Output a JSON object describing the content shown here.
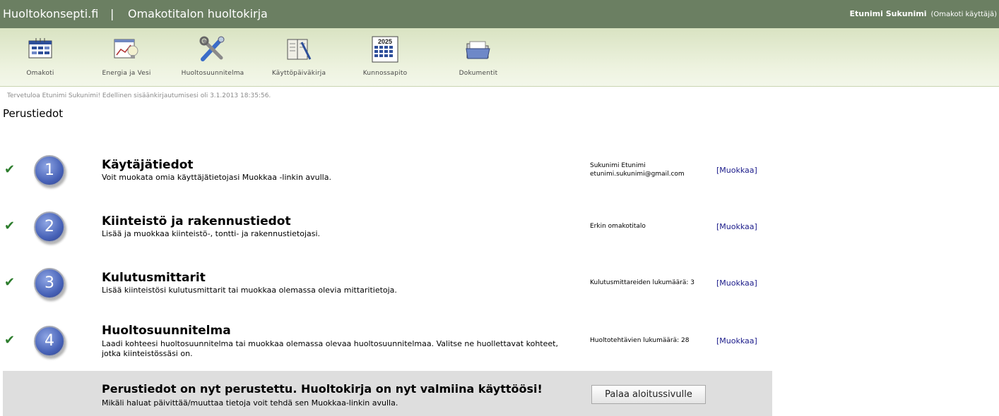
{
  "header": {
    "brand": "Huoltokonsepti.fi",
    "separator": "|",
    "app_title": "Omakotitalon huoltokirja",
    "user_name": "Etunimi Sukunimi",
    "user_role": "(Omakoti käyttäjä)"
  },
  "toolbar": {
    "items": [
      {
        "label": "Omakoti",
        "icon": "calendar-grid-icon"
      },
      {
        "label": "Energia ja Vesi",
        "icon": "chart-lightbulb-icon"
      },
      {
        "label": "Huoltosuunnitelma",
        "icon": "tools-icon"
      },
      {
        "label": "Käyttöpäiväkirja",
        "icon": "notebook-pen-icon"
      },
      {
        "label": "Kunnossapito",
        "icon": "calendar-2025-icon",
        "icon_text": "2025"
      },
      {
        "label": "Dokumentit",
        "icon": "folder-icon"
      }
    ]
  },
  "welcome": "Tervetuloa Etunimi Sukunimi! Edellinen sisäänkirjautumisesi oli 3.1.2013 18:35:56.",
  "page_title": "Perustiedot",
  "steps": [
    {
      "number": "1",
      "title": "Käytäjätiedot",
      "desc": "Voit muokata omia käyttäjätietojasi Muokkaa -linkin avulla.",
      "info_line1": "Sukunimi Etunimi",
      "info_line2": "etunimi.sukunimi@gmail.com",
      "edit": "[Muokkaa]",
      "check": "✔"
    },
    {
      "number": "2",
      "title": "Kiinteistö ja rakennustiedot",
      "desc": "Lisää ja muokkaa kiinteistö-, tontti- ja rakennustietojasi.",
      "info_line1": "Erkin omakotitalo",
      "info_line2": "",
      "edit": "[Muokkaa]",
      "check": "✔"
    },
    {
      "number": "3",
      "title": "Kulutusmittarit",
      "desc": "Lisää kiinteistösi kulutusmittarit tai muokkaa olemassa olevia mittaritietoja.",
      "info_line1": "Kulutusmittareiden lukumäärä: 3",
      "info_line2": "",
      "edit": "[Muokkaa]",
      "check": "✔"
    },
    {
      "number": "4",
      "title": "Huoltosuunnitelma",
      "desc": "Laadi kohteesi huoltosuunnitelma tai muokkaa olemassa olevaa huoltosuunnitelmaa. Valitse ne huollettavat kohteet, jotka kiinteistössäsi on.",
      "info_line1": "Huoltotehtävien lukumäärä: 28",
      "info_line2": "",
      "edit": "[Muokkaa]",
      "check": "✔"
    }
  ],
  "footer": {
    "title": "Perustiedot on nyt perustettu. Huoltokirja on nyt valmiina käyttöösi!",
    "desc": "Mikäli haluat päivittää/muuttaa tietoja voit tehdä sen Muokkaa-linkin avulla.",
    "button": "Palaa aloitussivulle"
  }
}
